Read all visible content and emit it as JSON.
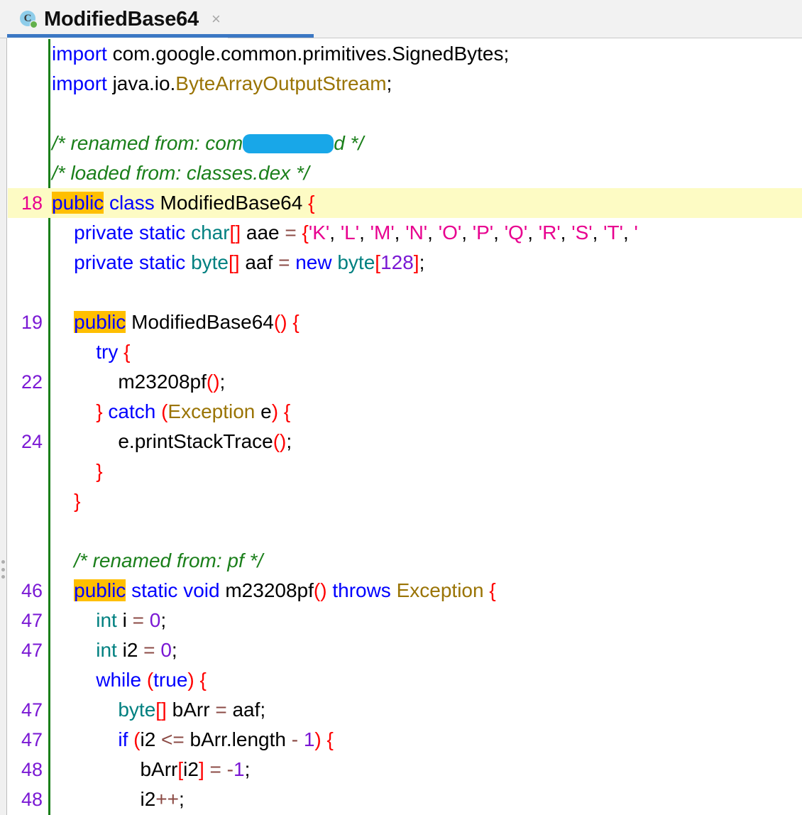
{
  "tab": {
    "title": "ModifiedBase64",
    "icon": "java-class-icon",
    "icon_letter": "C",
    "close_label": "×",
    "accent_color": "#3b78c4"
  },
  "editor": {
    "language": "java",
    "colors": {
      "keyword": "#0000ff",
      "type": "#008080",
      "comment": "#1a7f1a",
      "class_name": "#9a7405",
      "number": "#7a18d4",
      "string": "#e8008f",
      "bracket": "#ff0000",
      "operator": "#8b4a44",
      "search_match_highlight": "#ffbf00",
      "caret_line_highlight": "#fdfbc4",
      "line_number": "#7a18d4",
      "line_number_current": "#e8008f",
      "change_marker": "#1a7f1a",
      "redaction": "#18a7e8"
    },
    "lines": [
      {
        "no": "",
        "text": "import com.google.common.primitives.SignedBytes;"
      },
      {
        "no": "",
        "text": "import java.io.ByteArrayOutputStream;"
      },
      {
        "no": "",
        "text": ""
      },
      {
        "no": "",
        "text": "/* renamed from: com███████d */"
      },
      {
        "no": "",
        "text": "/* loaded from: classes.dex */"
      },
      {
        "no": "18",
        "text": "public class ModifiedBase64 {"
      },
      {
        "no": "",
        "text": "    private static char[] aae = {'K', 'L', 'M', 'N', 'O', 'P', 'Q', 'R', 'S', 'T', '"
      },
      {
        "no": "",
        "text": "    private static byte[] aaf = new byte[128];"
      },
      {
        "no": "",
        "text": ""
      },
      {
        "no": "19",
        "text": "    public ModifiedBase64() {"
      },
      {
        "no": "",
        "text": "        try {"
      },
      {
        "no": "22",
        "text": "            m23208pf();"
      },
      {
        "no": "",
        "text": "        } catch (Exception e) {"
      },
      {
        "no": "24",
        "text": "            e.printStackTrace();"
      },
      {
        "no": "",
        "text": "        }"
      },
      {
        "no": "",
        "text": "    }"
      },
      {
        "no": "",
        "text": ""
      },
      {
        "no": "",
        "text": "    /* renamed from: pf */"
      },
      {
        "no": "46",
        "text": "    public static void m23208pf() throws Exception {"
      },
      {
        "no": "47",
        "text": "        int i = 0;"
      },
      {
        "no": "47",
        "text": "        int i2 = 0;"
      },
      {
        "no": "",
        "text": "        while (true) {"
      },
      {
        "no": "47",
        "text": "            byte[] bArr = aaf;"
      },
      {
        "no": "47",
        "text": "            if (i2 <= bArr.length - 1) {"
      },
      {
        "no": "48",
        "text": "                bArr[i2] = -1;"
      },
      {
        "no": "48",
        "text": "                i2++;"
      }
    ],
    "redacted_comment": {
      "prefix": "/* renamed from: com",
      "suffix": "d */",
      "note": "redacted-text-block"
    },
    "highlighted_token": "public",
    "current_line_number": "18"
  }
}
